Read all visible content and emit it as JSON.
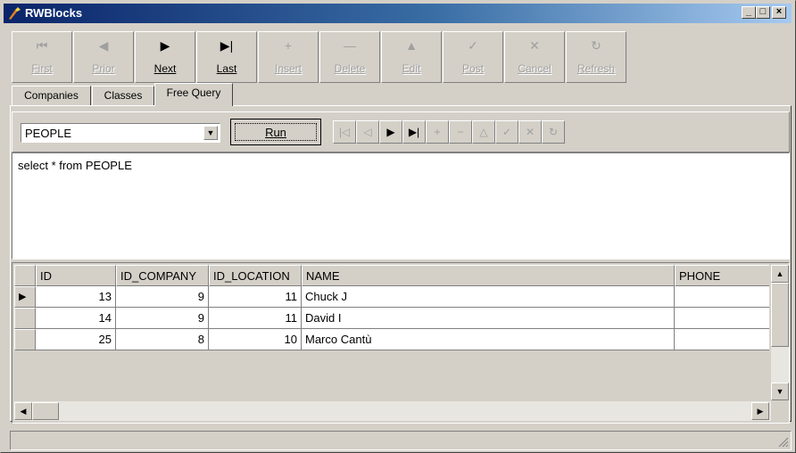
{
  "window": {
    "title": "RWBlocks",
    "min_label": "_",
    "max_label": "□",
    "close_label": "×"
  },
  "navigator": [
    {
      "label": "First",
      "icon": "⏮",
      "enabled": false
    },
    {
      "label": "Prior",
      "icon": "◀",
      "enabled": false
    },
    {
      "label": "Next",
      "icon": "▶",
      "enabled": true
    },
    {
      "label": "Last",
      "icon": "▶|",
      "enabled": true
    },
    {
      "label": "Insert",
      "icon": "+",
      "enabled": false
    },
    {
      "label": "Delete",
      "icon": "—",
      "enabled": false
    },
    {
      "label": "Edit",
      "icon": "▲",
      "enabled": false
    },
    {
      "label": "Post",
      "icon": "✓",
      "enabled": false
    },
    {
      "label": "Cancel",
      "icon": "✕",
      "enabled": false
    },
    {
      "label": "Refresh",
      "icon": "↻",
      "enabled": false
    }
  ],
  "tabs": {
    "items": [
      "Companies",
      "Classes",
      "Free Query"
    ],
    "active": "Free Query"
  },
  "query": {
    "table_select": "PEOPLE",
    "run_label": "Run",
    "sql": "select * from PEOPLE"
  },
  "grid": {
    "columns": [
      "ID",
      "ID_COMPANY",
      "ID_LOCATION",
      "NAME",
      "PHONE"
    ],
    "rows": [
      [
        "13",
        "9",
        "11",
        "Chuck J",
        ""
      ],
      [
        "14",
        "9",
        "11",
        "David I",
        ""
      ],
      [
        "25",
        "8",
        "10",
        "Marco Cantù",
        ""
      ]
    ],
    "current_row_marker": "▶"
  },
  "statusbar": {
    "text": ""
  }
}
